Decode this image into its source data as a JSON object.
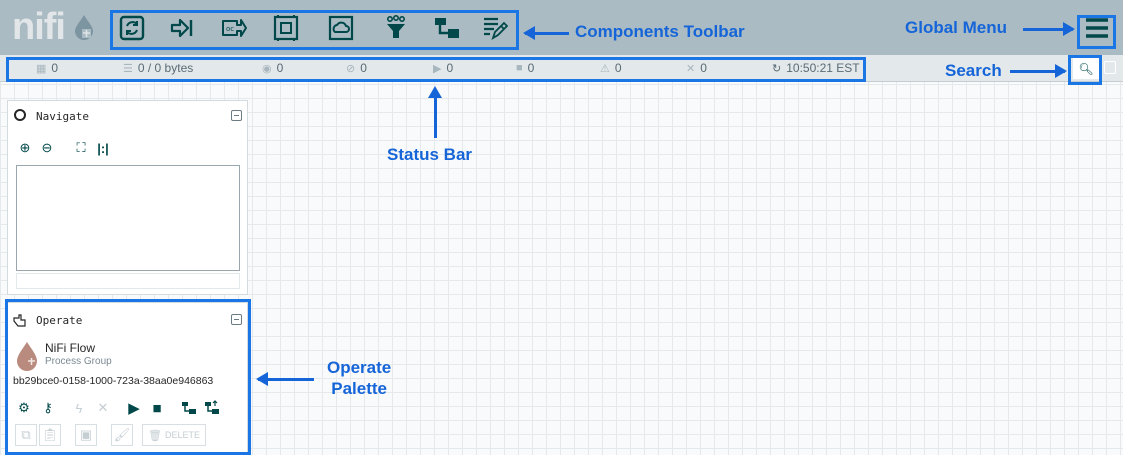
{
  "app": {
    "logo_text": "nifi"
  },
  "toolbar": {
    "tools": [
      {
        "name": "processor",
        "icon": "processor-icon"
      },
      {
        "name": "input-port",
        "icon": "input-port-icon"
      },
      {
        "name": "output-port",
        "icon": "output-port-icon"
      },
      {
        "name": "process-group",
        "icon": "process-group-icon"
      },
      {
        "name": "remote-process-group",
        "icon": "remote-process-group-icon"
      },
      {
        "name": "funnel",
        "icon": "funnel-icon"
      },
      {
        "name": "template",
        "icon": "template-icon"
      },
      {
        "name": "label",
        "icon": "label-icon"
      }
    ]
  },
  "status_bar": {
    "threads": "0",
    "queued": "0 / 0 bytes",
    "transmitting": "0",
    "not_transmitting": "0",
    "running": "0",
    "stopped": "0",
    "invalid": "0",
    "disabled": "0",
    "refresh_time": "10:50:21 EST"
  },
  "annotations": {
    "components_toolbar": "Components Toolbar",
    "global_menu": "Global Menu",
    "search": "Search",
    "status_bar": "Status Bar",
    "operate_palette_line1": "Operate",
    "operate_palette_line2": "Palette"
  },
  "navigate": {
    "title": "Navigate"
  },
  "operate": {
    "title": "Operate",
    "component_name": "NiFi Flow",
    "component_type": "Process Group",
    "component_id": "bb29bce0-0158-1000-723a-38aa0e946863",
    "delete_label": "DELETE"
  },
  "colors": {
    "accent": "#1a75e5",
    "teal": "#004849",
    "header_bg": "#aabbc3"
  }
}
